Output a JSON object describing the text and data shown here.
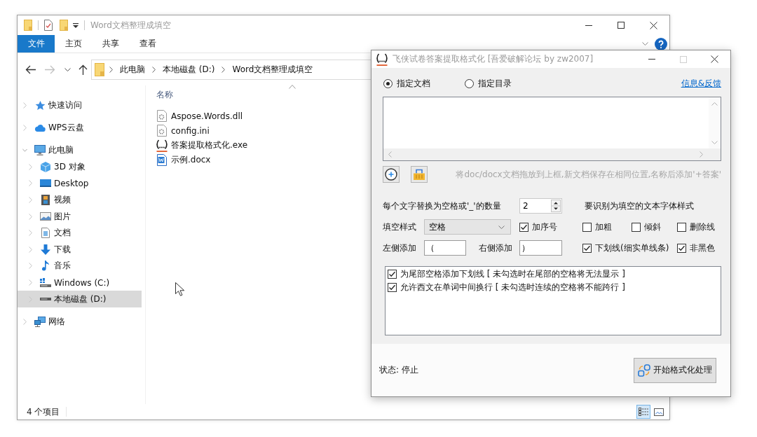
{
  "explorer": {
    "title": "Word文档整理成填空",
    "ribbon_tabs": [
      {
        "label": "文件",
        "selected": true
      },
      {
        "label": "主页",
        "selected": false
      },
      {
        "label": "共享",
        "selected": false
      },
      {
        "label": "查看",
        "selected": false
      }
    ],
    "address_path": [
      "此电脑",
      "本地磁盘 (D:)",
      "Word文档整理成填空"
    ],
    "navigation": [
      {
        "label": "快速访问",
        "kind": "star",
        "expanded": false,
        "selected": false
      },
      {
        "label": "WPS云盘",
        "kind": "cloud",
        "expanded": false,
        "selected": false
      },
      {
        "label": "此电脑",
        "kind": "computer",
        "expanded": true,
        "selected": false,
        "children": [
          {
            "label": "3D 对象",
            "kind": "cube",
            "expanded": false,
            "selected": false
          },
          {
            "label": "Desktop",
            "kind": "desktop",
            "expanded": false,
            "selected": false
          },
          {
            "label": "视频",
            "kind": "video",
            "expanded": false,
            "selected": false
          },
          {
            "label": "图片",
            "kind": "picture",
            "expanded": false,
            "selected": false
          },
          {
            "label": "文档",
            "kind": "document",
            "expanded": false,
            "selected": false
          },
          {
            "label": "下载",
            "kind": "download",
            "expanded": false,
            "selected": false
          },
          {
            "label": "音乐",
            "kind": "music",
            "expanded": false,
            "selected": false
          },
          {
            "label": "Windows (C:)",
            "kind": "system-drive",
            "expanded": false,
            "selected": false
          },
          {
            "label": "本地磁盘 (D:)",
            "kind": "drive",
            "expanded": false,
            "selected": true
          }
        ]
      },
      {
        "label": "网络",
        "kind": "network",
        "expanded": false,
        "selected": false
      }
    ],
    "column_header": "名称",
    "files": [
      {
        "name": "Aspose.Words.dll",
        "kind": "dll"
      },
      {
        "name": "config.ini",
        "kind": "ini"
      },
      {
        "name": "答案提取格式化.exe",
        "kind": "exe"
      },
      {
        "name": "示例.docx",
        "kind": "docx"
      }
    ],
    "status": "4 个项目",
    "view_modes": [
      {
        "kind": "details",
        "selected": true
      },
      {
        "kind": "large-icons",
        "selected": false
      }
    ]
  },
  "dialog": {
    "title": "飞侠试卷答案提取格式化 [吾爱破解论坛 by zw2007]",
    "source_options": [
      {
        "label": "指定文档",
        "selected": true
      },
      {
        "label": "指定目录",
        "selected": false
      }
    ],
    "info_link": "信息&反馈",
    "hint": "将doc/docx文档拖放到上框,新文档保存在相同位置,名称后添加'+答案'",
    "count_label": "每个文字替换为空格或'_'的数量",
    "count_value": "2",
    "font_style_heading": "要识别为填空的文本字体样式",
    "fill_style_label": "填空样式",
    "fill_style_value": "空格",
    "numbering": {
      "label": "加序号",
      "checked": true
    },
    "font_styles": [
      {
        "label": "加粗",
        "checked": false
      },
      {
        "label": "倾斜",
        "checked": false
      },
      {
        "label": "删除线",
        "checked": false
      },
      {
        "label": "下划线(细实单线条)",
        "checked": true
      },
      {
        "label": "非黑色",
        "checked": true
      }
    ],
    "left_add_label": "左侧添加",
    "left_add_value": "（",
    "right_add_label": "右侧添加",
    "right_add_value": "）",
    "options": [
      {
        "label": "为尾部空格添加下划线 [ 未勾选时在尾部的空格将无法显示 ]",
        "checked": true
      },
      {
        "label": "允许西文在单词中间换行 [ 未勾选时连续的空格将不能跨行 ]",
        "checked": true
      }
    ],
    "status": "状态: 停止",
    "start_button": "开始格式化处理"
  }
}
